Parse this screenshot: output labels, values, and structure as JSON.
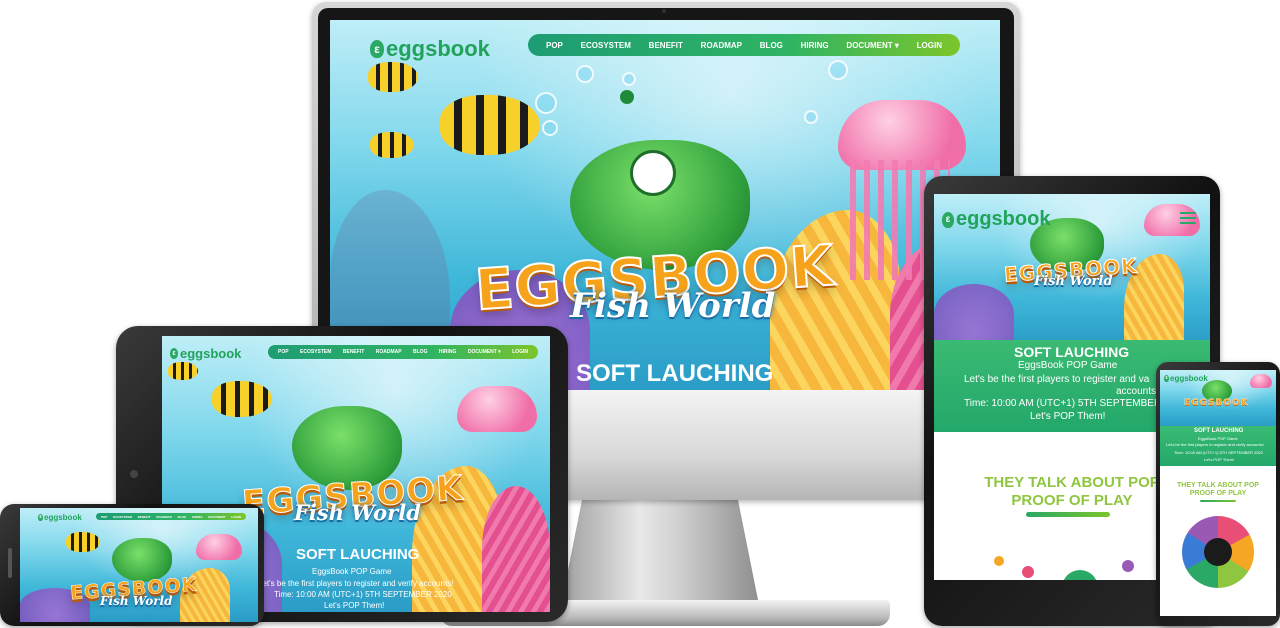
{
  "site": {
    "logo_text": "eggsbook",
    "nav": [
      "POP",
      "ECOSYSTEM",
      "BENEFIT",
      "ROADMAP",
      "BLOG",
      "HIRING",
      "DOCUMENT",
      "LOGIN"
    ],
    "nav_dropdown_glyph": "▾",
    "hero_title": "EGGSBOOK",
    "hero_subtitle": "Fish World",
    "section_title": "SOFT LAUCHING",
    "game_name": "EggsBook POP Game",
    "invite_line": "Let's be the first players to register and verify accounts!",
    "invite_short": "Let's be the first players to register and va",
    "invite_short2": "accounts!",
    "time_line": "Time: 10:00 AM (UTC+1) 5TH SEPTEMBER 2020",
    "time_short": "Time: 10:00 AM (UTC+1) 5TH SEPTEMBER 20",
    "cta_line": "Let's POP Them!",
    "talk_title_1": "THEY TALK ABOUT POP",
    "talk_title_2": "PROOF OF PLAY"
  },
  "colors": {
    "brand_green": "#22a35b",
    "nav_gradient_start": "#1e9c74",
    "nav_gradient_end": "#7cc52b",
    "title_orange": "#f6a21a",
    "talk_green": "#8fc63f"
  },
  "icons": [
    "egg-logo-icon",
    "chevron-down-icon",
    "menu-icon"
  ]
}
